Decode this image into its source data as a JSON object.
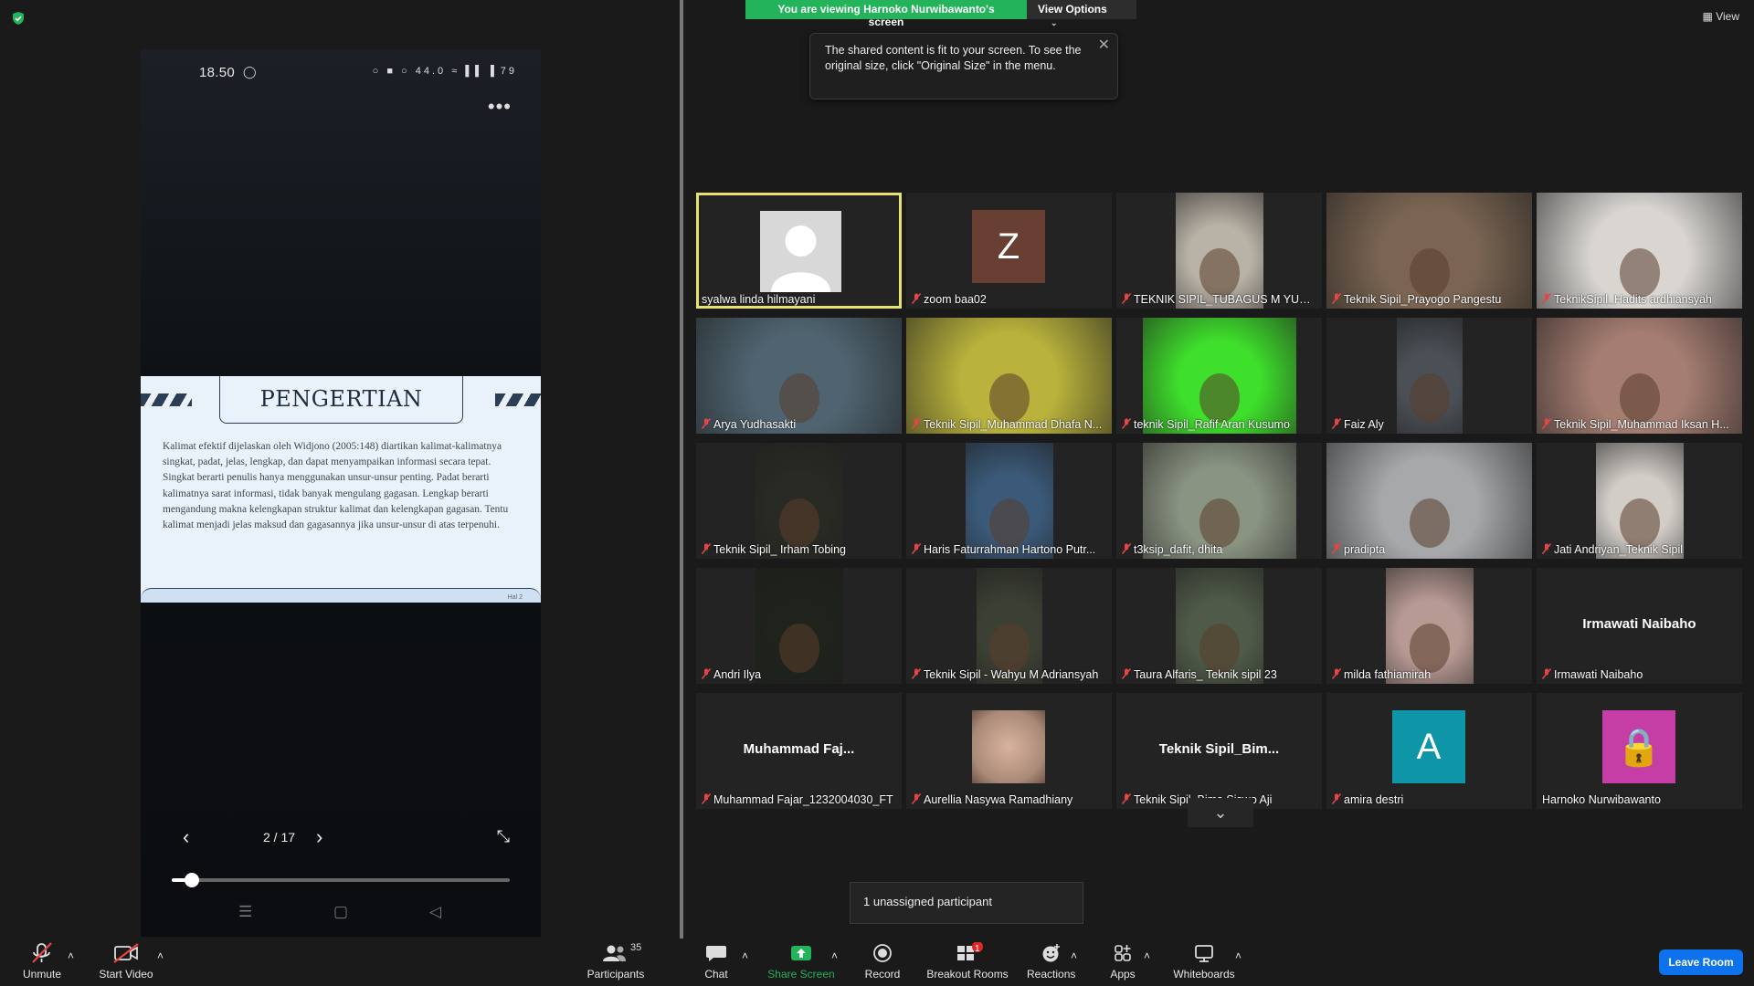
{
  "phone": {
    "time": "18.50",
    "status_app": "◯",
    "status_icons": "○ ■ ○ 44.0 ≈ ▌▌ ▌79",
    "more": "•••",
    "slide_title": "PENGERTIAN",
    "slide_body": "Kalimat efektif dijelaskan oleh Widjono (2005:148) diartikan kalimat-kalimatnya singkat, padat, jelas, lengkap, dan dapat menyampaikan informasi secara tepat. Singkat berarti penulis hanya menggunakan unsur-unsur penting. Padat berarti kalimatnya sarat informasi, tidak banyak mengulang gagasan. Lengkap berarti mengandung makna kelengkapan struktur kalimat dan kelengkapan gagasan. Tentu kalimat menjadi jelas maksud dan gagasannya jika unsur-unsur di atas terpenuhi.",
    "slide_page": "Hal 2",
    "page_indicator": "2 / 17",
    "progress": 0.06,
    "prev_icon": "‹",
    "next_icon": "›",
    "fullscreen_icon": "⤡",
    "sys_menu": "☰",
    "sys_home": "▢",
    "sys_back": "◁"
  },
  "banner": {
    "viewing": "You are viewing Harnoko Nurwibawanto's screen",
    "view_options": "View Options",
    "caret": "⌄",
    "tooltip": "The shared content is fit to your screen. To see the original size, click \"Original Size\" in the menu.",
    "close": "✕",
    "view": "▦ View"
  },
  "participants": [
    {
      "name": "syalwa linda hilmayani",
      "muted": false,
      "active": true,
      "kind": "avatar-gray"
    },
    {
      "name": "zoom baa02",
      "muted": true,
      "kind": "letter",
      "letter": "Z",
      "color": "#6a3f33"
    },
    {
      "name": "TEKNIK SIPIL_TUBAGUS M YUSU...",
      "muted": true,
      "kind": "video",
      "tone": "#b9b2a6",
      "w": 96
    },
    {
      "name": "Teknik Sipil_Prayogo Pangestu",
      "muted": true,
      "kind": "video",
      "tone": "#7b6552",
      "w": 225
    },
    {
      "name": "TeknikSipil_Hadits ardhiansyah",
      "muted": true,
      "kind": "video",
      "tone": "#d9d6d2",
      "w": 225
    },
    {
      "name": "Arya Yudhasakti",
      "muted": true,
      "kind": "video",
      "tone": "#4f6470",
      "w": 225
    },
    {
      "name": "Teknik Sipil_Muhammad Dhafa N...",
      "muted": true,
      "kind": "video",
      "tone": "#b9b23c",
      "w": 225
    },
    {
      "name": "teknik Sipil_Rafif Aran Kusumo",
      "muted": true,
      "kind": "video",
      "tone": "#3fe02c",
      "w": 168
    },
    {
      "name": "Faiz Aly",
      "muted": true,
      "kind": "video",
      "tone": "#4b5056",
      "w": 72
    },
    {
      "name": "Teknik Sipil_Muhammad Iksan H...",
      "muted": true,
      "kind": "video",
      "tone": "#a57d71",
      "w": 225
    },
    {
      "name": "Teknik Sipil_ Irham Tobing",
      "muted": true,
      "kind": "video",
      "tone": "#2a2a24",
      "w": 96
    },
    {
      "name": "Haris Faturrahman Hartono Putr...",
      "muted": true,
      "kind": "video",
      "tone": "#3b5a7a",
      "w": 96
    },
    {
      "name": "t3ksip_dafit, dhita",
      "muted": true,
      "kind": "video",
      "tone": "#8a9482",
      "w": 168
    },
    {
      "name": "pradipta",
      "muted": true,
      "kind": "video",
      "tone": "#a6a8aa",
      "w": 225
    },
    {
      "name": "Jati Andriyan_Teknik Sipil",
      "muted": true,
      "kind": "video",
      "tone": "#d2cdc7",
      "w": 96
    },
    {
      "name": "Andri Ilya",
      "muted": true,
      "kind": "video",
      "tone": "#1f231c",
      "w": 96
    },
    {
      "name": "Teknik Sipil - Wahyu M Adriansyah",
      "muted": true,
      "kind": "video",
      "tone": "#3c4034",
      "w": 72
    },
    {
      "name": "Taura Alfaris_ Teknik sipil 23",
      "muted": true,
      "kind": "video",
      "tone": "#4f5a48",
      "w": 96
    },
    {
      "name": "milda fathiamirah",
      "muted": true,
      "kind": "video",
      "tone": "#b89a94",
      "w": 96
    },
    {
      "name": "Irmawati Naibaho",
      "muted": true,
      "kind": "name",
      "big": "Irmawati Naibaho"
    },
    {
      "name": "Muhammad Fajar_1232004030_FT",
      "muted": true,
      "kind": "name",
      "big": "Muhammad  Faj..."
    },
    {
      "name": "Aurellia Nasywa Ramadhiany",
      "muted": true,
      "kind": "photo",
      "color": "#d8b39c"
    },
    {
      "name": "Teknik Sipil_Bima Siswo Aji",
      "muted": true,
      "kind": "name",
      "big": "Teknik  Sipil_Bim..."
    },
    {
      "name": "amira destri",
      "muted": true,
      "kind": "letter",
      "letter": "A",
      "color": "#0e96a8"
    },
    {
      "name": "Harnoko Nurwibawanto",
      "muted": false,
      "kind": "letter",
      "letter": "🔒",
      "color": "#c43ea6"
    }
  ],
  "grid_more": "⌄",
  "unassigned": "1 unassigned participant",
  "toolbar": {
    "unmute": "Unmute",
    "start_video": "Start Video",
    "participants": "Participants",
    "participants_count": "35",
    "chat": "Chat",
    "share_screen": "Share Screen",
    "record": "Record",
    "breakout_rooms": "Breakout Rooms",
    "breakout_badge": "1",
    "reactions": "Reactions",
    "apps": "Apps",
    "whiteboards": "Whiteboards",
    "leave_room": "Leave Room",
    "caret": "˄"
  },
  "colors": {
    "accent_green": "#23b35a",
    "leave_blue": "#0e72ed",
    "active_border": "#e6e272",
    "mute_red": "#e74444"
  }
}
